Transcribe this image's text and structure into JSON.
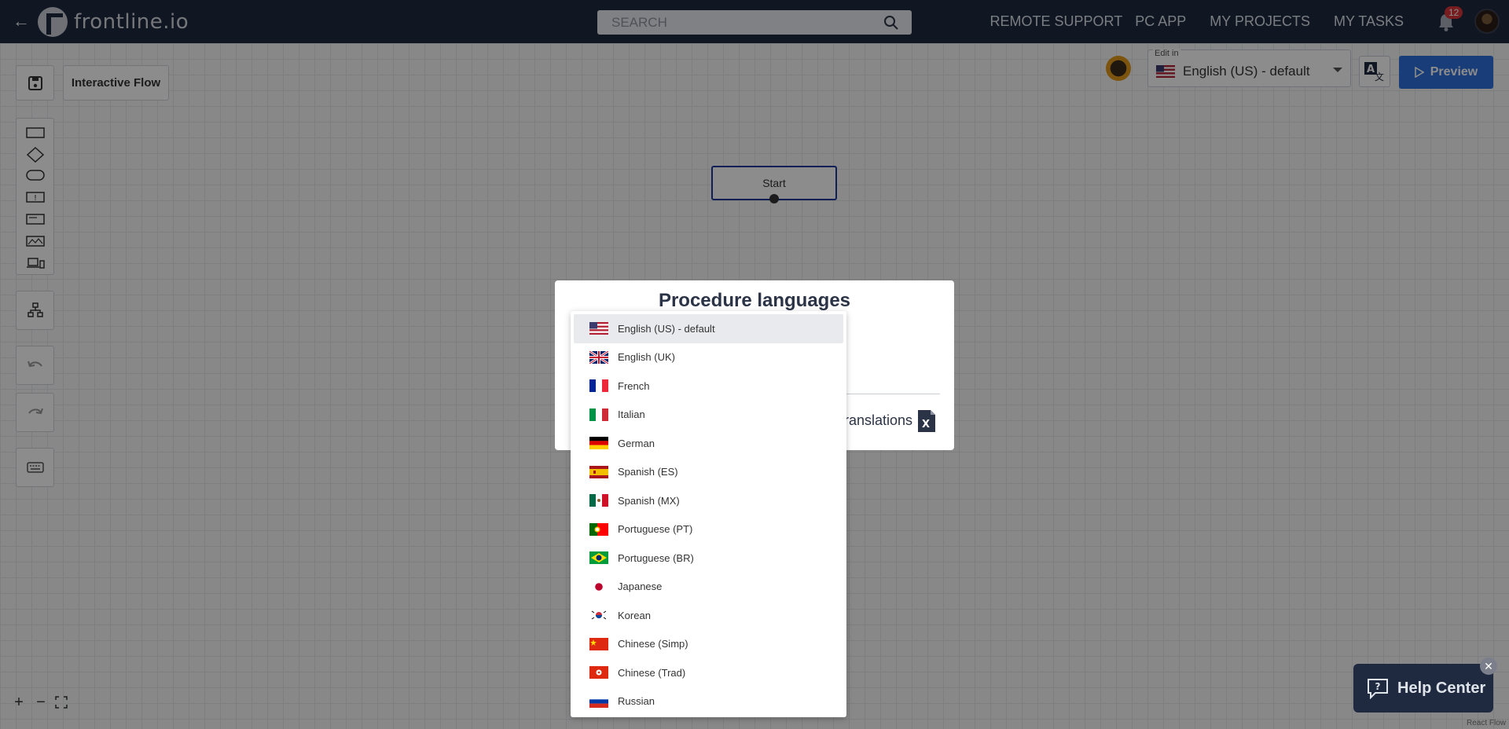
{
  "topbar": {
    "brand": "frontline.io",
    "search_placeholder": "SEARCH",
    "nav": [
      "REMOTE SUPPORT",
      "PC APP",
      "MY PROJECTS",
      "MY TASKS"
    ],
    "notifications_count": "12"
  },
  "editor": {
    "flow_name": "Interactive Flow",
    "edit_in_label": "Edit in",
    "edit_in_value": "English (US) - default",
    "preview_label": "Preview",
    "start_node_label": "Start",
    "react_flow_attribution": "React Flow"
  },
  "modal": {
    "title": "Procedure languages",
    "translations_link": "ranslations"
  },
  "languages": [
    {
      "label": "English (US) - default",
      "flag": "us",
      "selected": true
    },
    {
      "label": "English (UK)",
      "flag": "uk"
    },
    {
      "label": "French",
      "flag": "fr"
    },
    {
      "label": "Italian",
      "flag": "it"
    },
    {
      "label": "German",
      "flag": "de"
    },
    {
      "label": "Spanish (ES)",
      "flag": "es"
    },
    {
      "label": "Spanish (MX)",
      "flag": "mx"
    },
    {
      "label": "Portuguese (PT)",
      "flag": "pt"
    },
    {
      "label": "Portuguese (BR)",
      "flag": "br"
    },
    {
      "label": "Japanese",
      "flag": "jp"
    },
    {
      "label": "Korean",
      "flag": "kr"
    },
    {
      "label": "Chinese (Simp)",
      "flag": "cn"
    },
    {
      "label": "Chinese (Trad)",
      "flag": "hk"
    },
    {
      "label": "Russian",
      "flag": "ru"
    }
  ],
  "help_center": {
    "label": "Help Center"
  },
  "colors": {
    "navbar": "#1f2940",
    "accent": "#2e6fdb",
    "badge": "#d9353a"
  }
}
